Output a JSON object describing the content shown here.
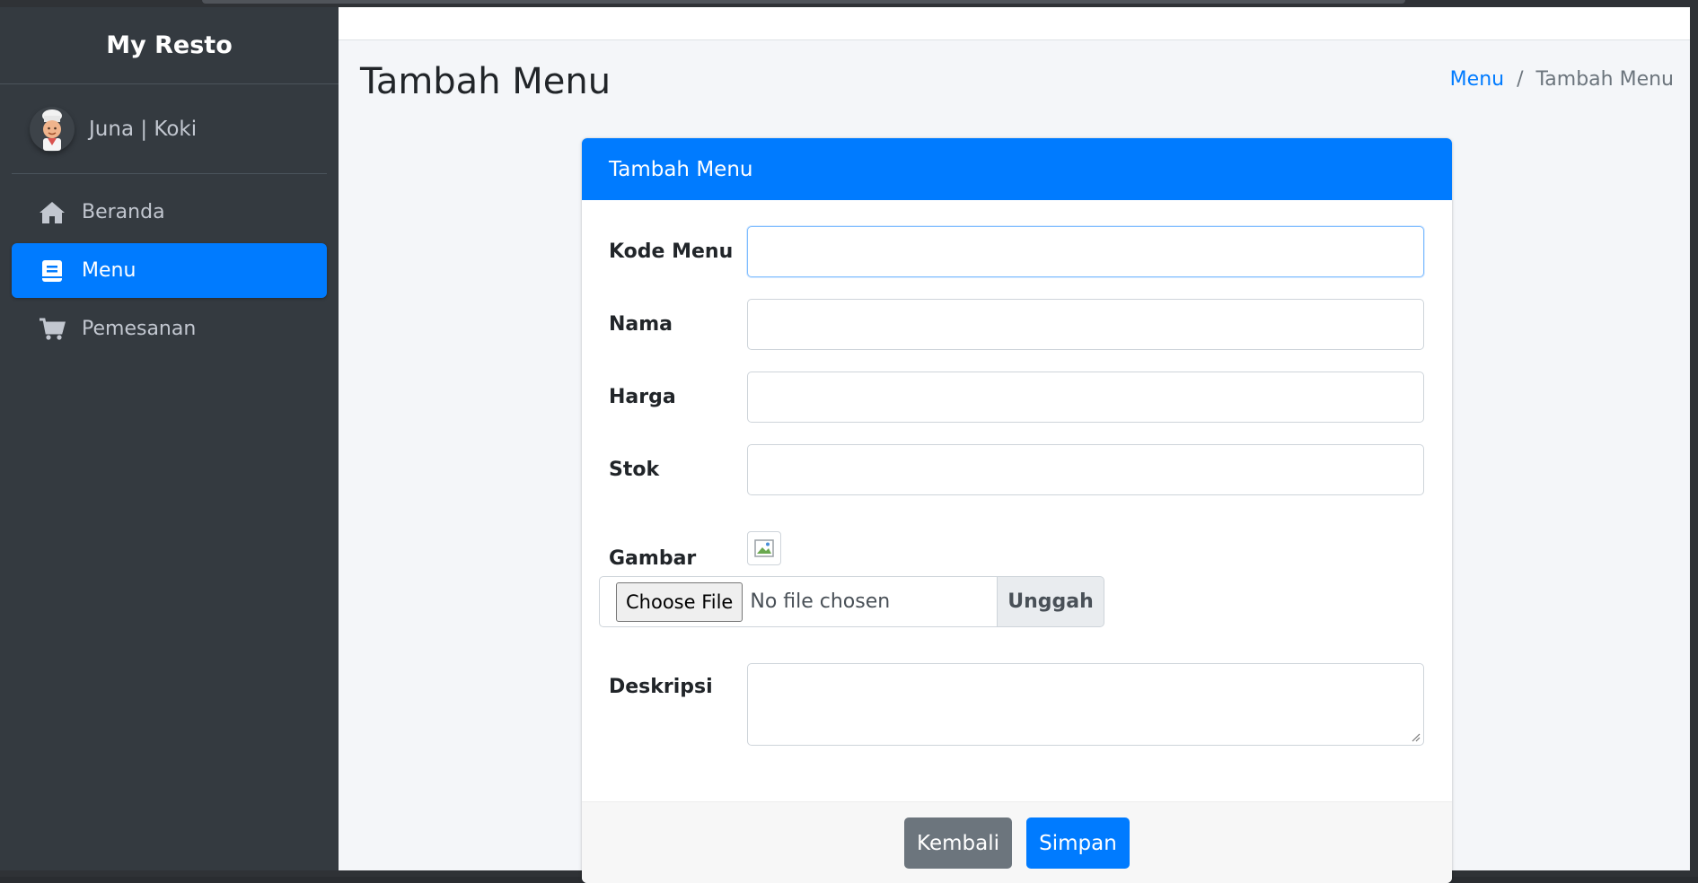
{
  "sidebar": {
    "brand": "My Resto",
    "user": "Juna | Koki",
    "items": [
      {
        "label": "Beranda",
        "icon": "home-icon"
      },
      {
        "label": "Menu",
        "icon": "book-icon",
        "active": true
      },
      {
        "label": "Pemesanan",
        "icon": "cart-icon"
      }
    ]
  },
  "header": {
    "title": "Tambah Menu",
    "breadcrumb": {
      "link": "Menu",
      "separator": "/",
      "current": "Tambah Menu"
    }
  },
  "form": {
    "card_title": "Tambah Menu",
    "fields": {
      "kode": {
        "label": "Kode Menu",
        "value": ""
      },
      "nama": {
        "label": "Nama",
        "value": ""
      },
      "harga": {
        "label": "Harga",
        "value": ""
      },
      "stok": {
        "label": "Stok",
        "value": ""
      },
      "gambar": {
        "label": "Gambar"
      },
      "deskripsi": {
        "label": "Deskripsi",
        "value": ""
      }
    },
    "file": {
      "choose_label": "Choose File",
      "status": "No file chosen",
      "upload_label": "Unggah"
    },
    "buttons": {
      "back": "Kembali",
      "save": "Simpan"
    }
  },
  "colors": {
    "primary": "#007bff",
    "sidebar": "#343a40",
    "secondary": "#6c757d"
  }
}
